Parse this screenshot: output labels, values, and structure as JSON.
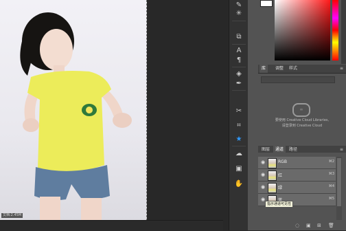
{
  "status": {
    "doc_info": "文档:2.45M"
  },
  "panels": {
    "library_tabs": [
      {
        "label": "库"
      },
      {
        "label": "调整"
      },
      {
        "label": "样式"
      }
    ],
    "library_message_line1": "要使用 Creative Cloud Libraries,",
    "library_message_line2": "请登录到 Creative Cloud",
    "channel_tabs": [
      {
        "label": "图层"
      },
      {
        "label": "通道"
      },
      {
        "label": "路径"
      }
    ],
    "channels": [
      {
        "name": "RGB",
        "shortcut": "⌘2"
      },
      {
        "name": "红",
        "shortcut": "⌘3"
      },
      {
        "name": "绿",
        "shortcut": "⌘4"
      },
      {
        "name": "蓝",
        "shortcut": "⌘5"
      }
    ],
    "tooltip": "指示通道可见性"
  },
  "colors": {
    "accent": "#2f9bff",
    "panel_bg": "#535353",
    "shirt": "#ecec5a"
  },
  "icons": [
    "brush-icon",
    "eraser-icon",
    "gradient-icon",
    "text-icon",
    "path-select-icon",
    "pen-icon",
    "scissors-icon",
    "crop-icon",
    "star-icon",
    "cloud-icon",
    "image-icon",
    "hand-icon"
  ]
}
